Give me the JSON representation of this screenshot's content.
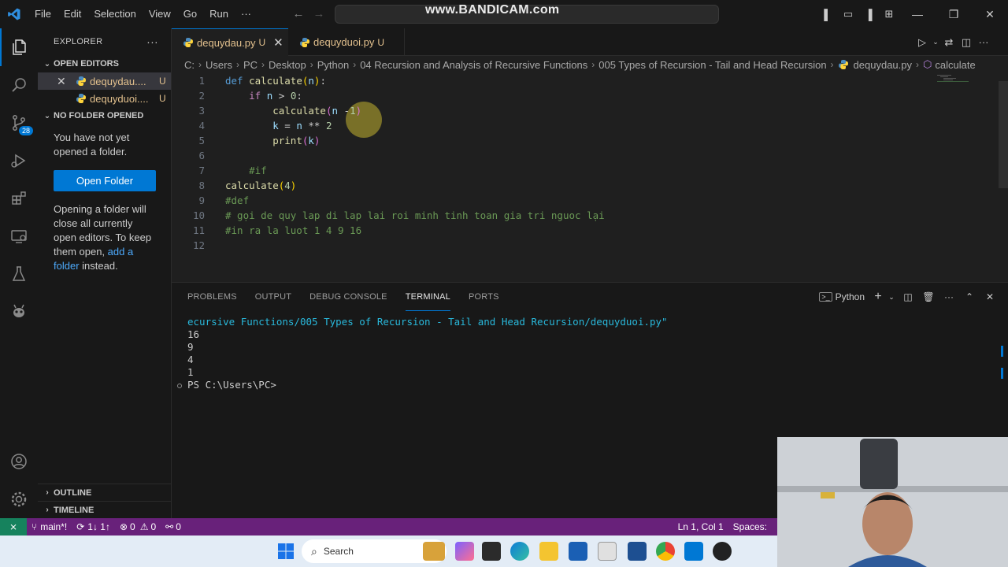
{
  "titlebar": {
    "menu": [
      "File",
      "Edit",
      "Selection",
      "View",
      "Go",
      "Run",
      "···"
    ],
    "watermark": "www.BANDICAM.com"
  },
  "activity": {
    "scm_badge": "28"
  },
  "sidebar": {
    "header": "EXPLORER",
    "more": "···",
    "open_editors_title": "OPEN EDITORS",
    "open_editors": [
      {
        "label": "dequydau....",
        "status": "U"
      },
      {
        "label": "dequyduoi....",
        "status": "U"
      }
    ],
    "no_folder_title": "NO FOLDER OPENED",
    "no_folder_text": "You have not yet opened a folder.",
    "open_folder_button": "Open Folder",
    "opening_text_1": "Opening a folder will close all currently open editors. To keep them open, ",
    "add_folder_link": "add a folder",
    "opening_text_2": " instead.",
    "outline": "OUTLINE",
    "timeline": "TIMELINE"
  },
  "tabs": [
    {
      "label": "dequydau.py",
      "status": "U"
    },
    {
      "label": "dequyduoi.py",
      "status": "U"
    }
  ],
  "breadcrumb": [
    "C:",
    "Users",
    "PC",
    "Desktop",
    "Python",
    "04 Recursion and Analysis of Recursive Functions",
    "005 Types of Recursion - Tail and Head Recursion",
    "dequydau.py",
    "calculate"
  ],
  "editor": {
    "line_numbers": [
      "1",
      "2",
      "3",
      "4",
      "5",
      "6",
      "7",
      "8",
      "9",
      "10",
      "11",
      "12"
    ],
    "l1": {
      "kw": "def",
      "sp": " ",
      "fn": "calculate",
      "open": "(",
      "param": "n",
      "close": ")",
      "colon": ":"
    },
    "l2": {
      "indent": "    ",
      "kw": "if",
      "sp": " ",
      "param": "n",
      "op": " > ",
      "num": "0",
      "colon": ":"
    },
    "l3": {
      "indent": "        ",
      "fn": "calculate",
      "open": "(",
      "param": "n",
      "op": " -",
      "num": "1",
      "close": ")"
    },
    "l4": {
      "indent": "        ",
      "var": "k",
      "op": " = ",
      "param": "n",
      "op2": " ** ",
      "num": "2"
    },
    "l5": {
      "indent": "        ",
      "fn": "print",
      "open": "(",
      "var": "k",
      "close": ")"
    },
    "l7": {
      "indent": "    ",
      "comment": "#if"
    },
    "l8": {
      "fn": "calculate",
      "open": "(",
      "num": "4",
      "close": ")"
    },
    "l9": {
      "comment": "#def"
    },
    "l10": {
      "comment": "# gọi de quy lap di lap lai roi minh tinh toan gia tri nguoc lại"
    },
    "l11": {
      "comment": "#in ra la luot 1 4 9 16"
    }
  },
  "panel": {
    "tabs": [
      "PROBLEMS",
      "OUTPUT",
      "DEBUG CONSOLE",
      "TERMINAL",
      "PORTS"
    ],
    "active_tab": "TERMINAL",
    "shell": "Python",
    "terminal_lines": [
      "ecursive Functions/005 Types of Recursion - Tail and Head Recursion/dequyduoi.py\"",
      "16",
      "9",
      "4",
      "1",
      "PS C:\\Users\\PC>"
    ]
  },
  "statusbar": {
    "branch": "main*!",
    "sync": "1↓ 1↑",
    "errors": "0",
    "warnings": "0",
    "ports": "0",
    "position": "Ln 1, Col 1",
    "spaces": "Spaces:"
  },
  "taskbar": {
    "search_placeholder": "Search"
  },
  "colors": {
    "accent": "#0078d4",
    "statusbar": "#68217a",
    "modified": "#e2c08d"
  }
}
